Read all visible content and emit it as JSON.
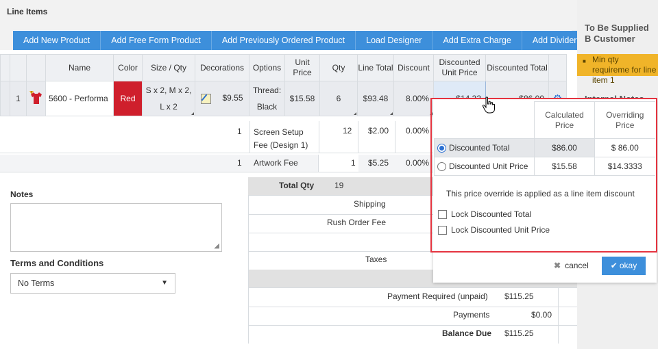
{
  "section_title": "Line Items",
  "toolbar": [
    "Add New Product",
    "Add Free Form Product",
    "Add Previously Ordered Product",
    "Load Designer",
    "Add Extra Charge",
    "Add Divider"
  ],
  "headers": {
    "name": "Name",
    "color": "Color",
    "size": "Size / Qty",
    "decorations": "Decorations",
    "options": "Options",
    "unit_price": "Unit Price",
    "qty": "Qty",
    "line_total": "Line Total",
    "discount": "Discount",
    "disc_unit": "Discounted Unit Price",
    "disc_total": "Discounted Total"
  },
  "row1": {
    "num": "1",
    "name": "5600 - Performa",
    "color": "Red",
    "size": "S x 2, M x 2, L x 2",
    "deco_price": "$9.55",
    "option": "Thread: Black",
    "unit_price": "$15.58",
    "qty": "6",
    "line_total": "$93.48",
    "discount": "8.00%",
    "disc_unit": "$14.33",
    "disc_total": "$86.00"
  },
  "row2": {
    "num": "1",
    "name": "Screen Setup Fee (Design 1)",
    "qty": "12",
    "price": "$2.00",
    "discount": "0.00%"
  },
  "row3": {
    "num": "1",
    "name": "Artwork Fee",
    "qty": "1",
    "price": "$5.25",
    "discount": "0.00%"
  },
  "notes_label": "Notes",
  "terms_label": "Terms and Conditions",
  "terms_value": "No Terms",
  "totals": {
    "total_qty_label": "Total Qty",
    "total_qty": "19",
    "shipping": "Shipping",
    "rush": "Rush Order Fee",
    "taxes": "Taxes",
    "payment_required_label": "Payment Required (unpaid)",
    "payment_required": "$115.25",
    "payments_label": "Payments",
    "payments": "$0.00",
    "balance_label": "Balance Due",
    "balance": "$115.25"
  },
  "sidebar": {
    "title": "To Be Supplied B Customer",
    "warning": "Min qty requireme for line item 1",
    "internal_notes": "Internal Notes"
  },
  "popup": {
    "col_calc": "Calculated Price",
    "col_override": "Overriding Price",
    "opt1": "Discounted Total",
    "opt1_calc": "$86.00",
    "opt1_over": "$   86.00",
    "opt2": "Discounted Unit Price",
    "opt2_calc": "$15.58",
    "opt2_over": "$14.3333",
    "note": "This price override is applied as a line item discount",
    "lock1": "Lock Discounted Total",
    "lock2": "Lock Discounted Unit Price",
    "cancel": "cancel",
    "ok": "okay"
  },
  "colors": {
    "accent": "#3d8fdb",
    "highlight": "#e5333f",
    "product_red": "#cf1f2c",
    "warning": "#f0b429"
  }
}
